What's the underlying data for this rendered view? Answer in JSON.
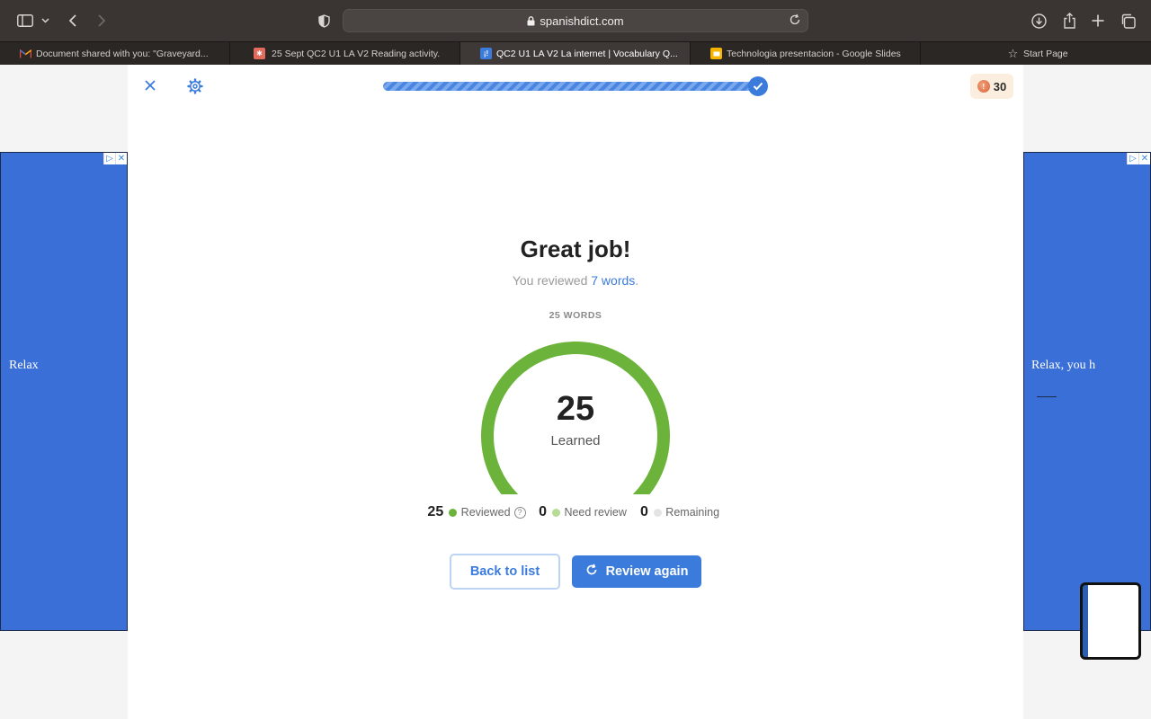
{
  "browser": {
    "url": "spanishdict.com",
    "tabs": [
      {
        "label": "Document shared with you: \"Graveyard...",
        "favicon": "gmail-icon",
        "color": "#ffffff",
        "active": false
      },
      {
        "label": "25 Sept QC2 U1 LA V2 Reading activity.",
        "favicon": "quizlet-icon",
        "color": "#e36b5c",
        "active": false
      },
      {
        "label": "QC2 U1 LA V2 La internet | Vocabulary Q...",
        "favicon": "spanishdict-icon",
        "color": "#3b7bdc",
        "active": true
      },
      {
        "label": "Technologia presentacion - Google Slides",
        "favicon": "slides-icon",
        "color": "#f4b400",
        "active": false
      },
      {
        "label": "Start Page",
        "favicon": "star-icon",
        "color": "#d2cfcc",
        "active": false
      }
    ]
  },
  "quiz": {
    "progress": 1.0,
    "streak": "30",
    "headline": "Great job!",
    "subline_prefix": "You reviewed",
    "subline_link": "7 words",
    "subline_suffix": ".",
    "word_count_label": "25 WORDS",
    "learned_value": "25",
    "learned_label": "Learned",
    "stats": [
      {
        "value": "25",
        "label": "Reviewed",
        "color": "#6bb33a"
      },
      {
        "value": "0",
        "label": "Need review",
        "color": "#b6dc95"
      },
      {
        "value": "0",
        "label": "Remaining",
        "color": "#e4e4e4"
      }
    ],
    "back_button": "Back to list",
    "review_button": "Review again"
  },
  "ads": {
    "left_text": "Relax",
    "right_text": "Relax, you h"
  },
  "colors": {
    "accent": "#3b7bdc",
    "gauge": "#6bb33a"
  }
}
